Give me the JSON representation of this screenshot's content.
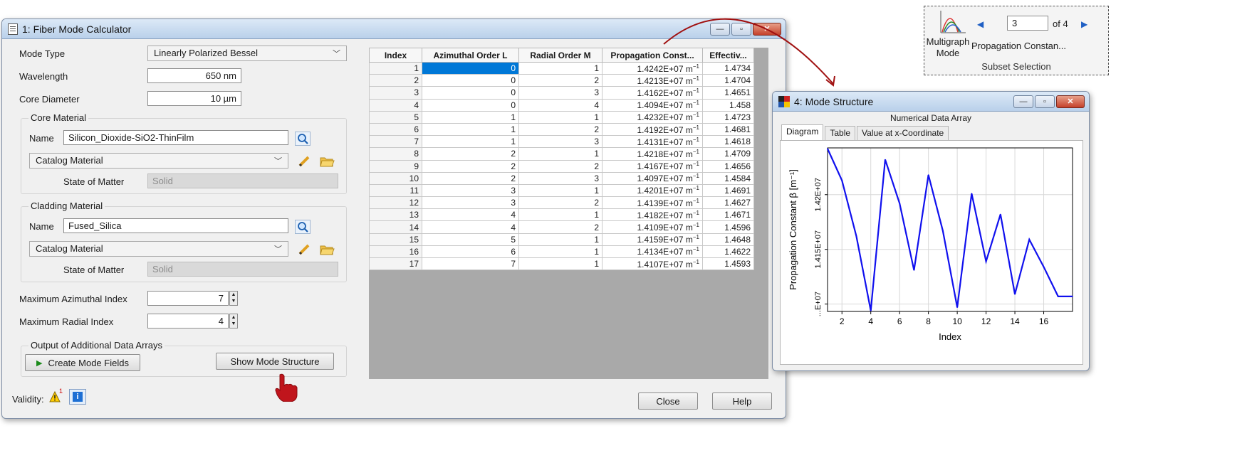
{
  "calc_window": {
    "title": "1: Fiber Mode Calculator",
    "mode_type_label": "Mode Type",
    "mode_type_value": "Linearly Polarized Bessel",
    "wavelength_label": "Wavelength",
    "wavelength_value": "650 nm",
    "core_diameter_label": "Core Diameter",
    "core_diameter_value": "10 µm",
    "core_material": {
      "group_title": "Core Material",
      "name_label": "Name",
      "name_value": "Silicon_Dioxide-SiO2-ThinFilm",
      "catalog_value": "Catalog Material",
      "state_label": "State of Matter",
      "state_value": "Solid"
    },
    "cladding_material": {
      "group_title": "Cladding Material",
      "name_label": "Name",
      "name_value": "Fused_Silica",
      "catalog_value": "Catalog Material",
      "state_label": "State of Matter",
      "state_value": "Solid"
    },
    "max_azimuthal_label": "Maximum Azimuthal Index",
    "max_azimuthal_value": "7",
    "max_radial_label": "Maximum Radial Index",
    "max_radial_value": "4",
    "output_group_title": "Output of Additional Data Arrays",
    "create_mode_fields_label": "Create Mode Fields",
    "show_mode_structure_label": "Show Mode Structure",
    "validity_label": "Validity:",
    "validity_badge": "1",
    "close_label": "Close",
    "help_label": "Help",
    "table": {
      "headers": [
        "Index",
        "Azimuthal Order L",
        "Radial Order M",
        "Propagation Const...",
        "Effectiv..."
      ],
      "rows": [
        [
          "1",
          "0",
          "1",
          "1.4242E+07 m",
          "1.4734"
        ],
        [
          "2",
          "0",
          "2",
          "1.4213E+07 m",
          "1.4704"
        ],
        [
          "3",
          "0",
          "3",
          "1.4162E+07 m",
          "1.4651"
        ],
        [
          "4",
          "0",
          "4",
          "1.4094E+07 m",
          "1.458"
        ],
        [
          "5",
          "1",
          "1",
          "1.4232E+07 m",
          "1.4723"
        ],
        [
          "6",
          "1",
          "2",
          "1.4192E+07 m",
          "1.4681"
        ],
        [
          "7",
          "1",
          "3",
          "1.4131E+07 m",
          "1.4618"
        ],
        [
          "8",
          "2",
          "1",
          "1.4218E+07 m",
          "1.4709"
        ],
        [
          "9",
          "2",
          "2",
          "1.4167E+07 m",
          "1.4656"
        ],
        [
          "10",
          "2",
          "3",
          "1.4097E+07 m",
          "1.4584"
        ],
        [
          "11",
          "3",
          "1",
          "1.4201E+07 m",
          "1.4691"
        ],
        [
          "12",
          "3",
          "2",
          "1.4139E+07 m",
          "1.4627"
        ],
        [
          "13",
          "4",
          "1",
          "1.4182E+07 m",
          "1.4671"
        ],
        [
          "14",
          "4",
          "2",
          "1.4109E+07 m",
          "1.4596"
        ],
        [
          "15",
          "5",
          "1",
          "1.4159E+07 m",
          "1.4648"
        ],
        [
          "16",
          "6",
          "1",
          "1.4134E+07 m",
          "1.4622"
        ],
        [
          "17",
          "7",
          "1",
          "1.4107E+07 m",
          "1.4593"
        ]
      ],
      "unit_superscript": "−1",
      "selected_row": 0
    }
  },
  "mode_window": {
    "title": "4: Mode Structure",
    "header": "Numerical Data Array",
    "tabs": [
      "Diagram",
      "Table",
      "Value at x-Coordinate"
    ],
    "active_tab": "Diagram",
    "y_tick_labels": [
      "...E+07",
      "1.415E+07",
      "1.42E+07"
    ],
    "x_tick_labels": [
      "2",
      "4",
      "6",
      "8",
      "10",
      "12",
      "14",
      "16"
    ]
  },
  "ribbon": {
    "multigraph_label_1": "Multigraph",
    "multigraph_label_2": "Mode",
    "subset_value": "3",
    "subset_of": "of 4",
    "propagation_label": "Propagation Constan...",
    "group_label": "Subset Selection"
  },
  "chart_data": {
    "type": "line",
    "xlabel": "Index",
    "ylabel": "Propagation Constant β [m⁻¹]",
    "x": [
      1,
      2,
      3,
      4,
      5,
      6,
      7,
      8,
      9,
      10,
      11,
      12,
      13,
      14,
      15,
      16,
      17,
      18
    ],
    "series": [
      {
        "values": [
          14242000,
          14213000,
          14162000,
          14094000,
          14232000,
          14192000,
          14131000,
          14218000,
          14167000,
          14097000,
          14201000,
          14139000,
          14182000,
          14109000,
          14159000,
          14134000,
          14107000,
          14107000
        ]
      }
    ],
    "xlim": [
      1,
      18
    ],
    "ylim": [
      14094000,
      14242000
    ],
    "line_color": "#1010ee"
  }
}
